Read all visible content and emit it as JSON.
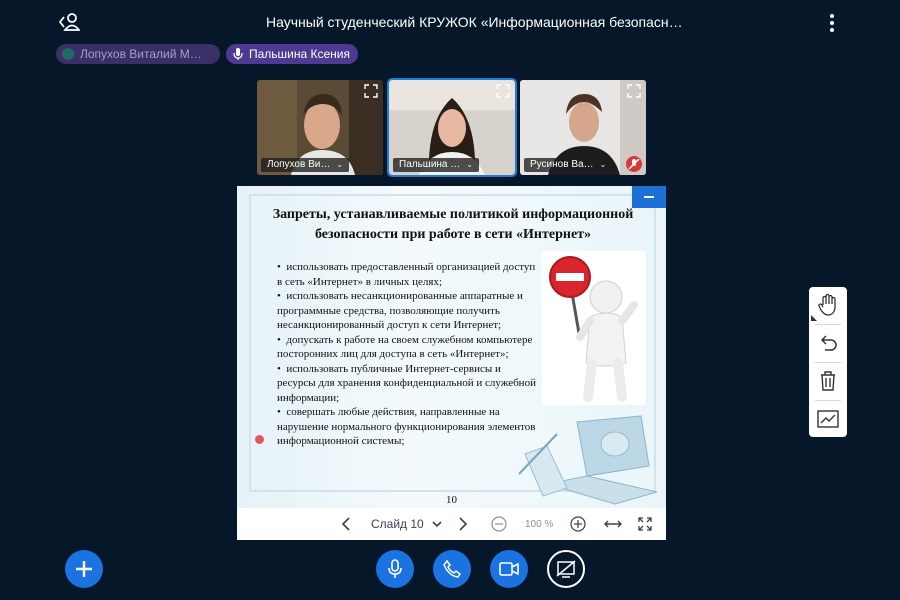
{
  "header": {
    "title": "Научный студенческий КРУЖОК «Информационная безопасн…"
  },
  "talkers": [
    {
      "name": "Лопухов Виталий М…",
      "state": "muted"
    },
    {
      "name": "Пальшина Ксения",
      "state": "talking"
    }
  ],
  "videos": [
    {
      "name": "Лопухов Ви…"
    },
    {
      "name": "Пальшина …"
    },
    {
      "name": "Русинов Ва…"
    }
  ],
  "slide": {
    "title": "Запреты, устанавливаемые политикой информационной безопасности при работе в сети «Интернет»",
    "bullets": [
      "использовать предоставленный организацией доступ в сеть «Интернет» в личных целях;",
      "использовать несанкционированные аппаратные и программные средства, позволяющие получить несанкционированный доступ к сети Интернет;",
      "допускать к работе на своем служебном компьютере посторонних лиц для доступа в сеть «Интернет»;",
      "использовать публичные Интернет-сервисы и ресурсы для хранения конфиденциальной и служебной информации;",
      "совершать любые действия, направленные на нарушение нормального функционирования элементов информационной системы;"
    ],
    "number": "10"
  },
  "presentation_toolbar": {
    "slide_label": "Слайд 10",
    "zoom": "100 %"
  },
  "colors": {
    "background": "#06172a",
    "accent": "#1a73e0",
    "talker_pill": "#4e3a93"
  },
  "icons": [
    "users-icon",
    "kebab-icon",
    "microphone-icon",
    "expand-icon",
    "hand-icon",
    "undo-icon",
    "trash-icon",
    "chart-icon",
    "plus-icon",
    "phone-icon",
    "camera-icon",
    "screen-share-off-icon"
  ]
}
